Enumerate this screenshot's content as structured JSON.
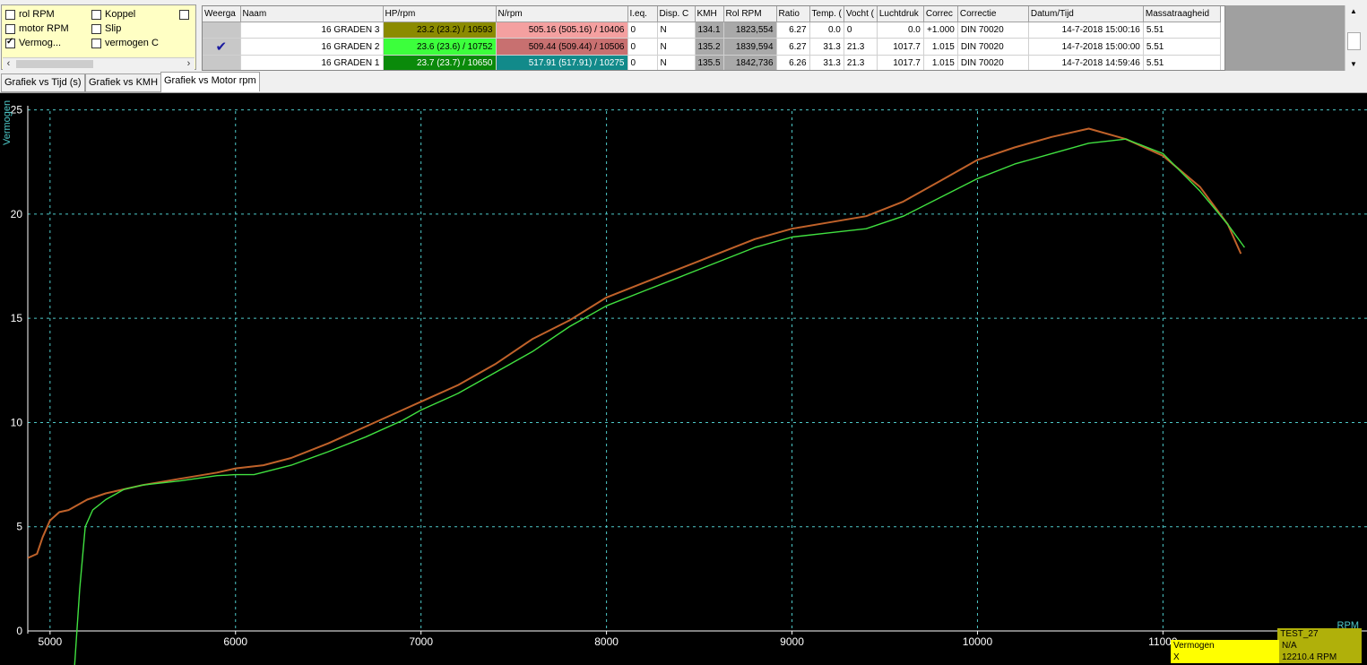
{
  "checkboxes": [
    {
      "label": "rol RPM",
      "checked": false
    },
    {
      "label": "Koppel",
      "checked": false
    },
    {
      "label": "",
      "checked": false
    },
    {
      "label": "motor RPM",
      "checked": false
    },
    {
      "label": "Slip",
      "checked": false
    },
    {
      "label": "Vermog...",
      "checked": true
    },
    {
      "label": "vermogen C",
      "checked": false
    }
  ],
  "table": {
    "columns": [
      "Weerga",
      "Naam",
      "HP/rpm",
      "N/rpm",
      "I.eq.",
      "Disp. C",
      "KMH",
      "Rol RPM",
      "Ratio",
      "Temp. (",
      "Vocht (",
      "Luchtdruk",
      "Correc",
      "Correctie",
      "Datum/Tijd",
      "Massatraagheid"
    ],
    "rows": [
      {
        "check": "",
        "name": "16 GRADEN 3",
        "hp": "23.2 (23.2) / 10593",
        "n": "505.16 (505.16) / 10406",
        "ieq": "0",
        "disp": "N",
        "kmh": "134.1",
        "rol": "1823,554",
        "ratio": "6.27",
        "temp": "0.0",
        "vocht": "0",
        "lucht": "0.0",
        "correc": "+1.000",
        "correctie": "DIN 70020",
        "datum": "14-7-2018 15:00:16",
        "massa": "5.51",
        "hp_color": "#8b8b00",
        "hp_text": "#000000",
        "n_color": "#f4a0a0",
        "n_text": "#000000"
      },
      {
        "check": "✔",
        "name": "16 GRADEN 2",
        "hp": "23.6 (23.6) / 10752",
        "n": "509.44 (509.44) / 10506",
        "ieq": "0",
        "disp": "N",
        "kmh": "135.2",
        "rol": "1839,594",
        "ratio": "6.27",
        "temp": "31.3",
        "vocht": "21.3",
        "lucht": "1017.7",
        "correc": "1.015",
        "correctie": "DIN 70020",
        "datum": "14-7-2018 15:00:00",
        "massa": "5.51",
        "hp_color": "#3cff3c",
        "hp_text": "#000000",
        "n_color": "#c87070",
        "n_text": "#000000"
      },
      {
        "check": "",
        "name": "16 GRADEN 1",
        "hp": "23.7 (23.7) / 10650",
        "n": "517.91 (517.91) / 10275",
        "ieq": "0",
        "disp": "N",
        "kmh": "135.5",
        "rol": "1842,736",
        "ratio": "6.26",
        "temp": "31.3",
        "vocht": "21.3",
        "lucht": "1017.7",
        "correc": "1.015",
        "correctie": "DIN 70020",
        "datum": "14-7-2018 14:59:46",
        "massa": "5.51",
        "hp_color": "#0a8a0a",
        "hp_text": "#ffffff",
        "n_color": "#128a8a",
        "n_text": "#ffffff"
      }
    ]
  },
  "tabs": [
    {
      "label": "Grafiek vs Tijd (s)",
      "active": false
    },
    {
      "label": "Grafiek vs KMH",
      "active": false
    },
    {
      "label": "Grafiek vs Motor rpm",
      "active": true
    }
  ],
  "legend": {
    "test": "TEST_27",
    "label": "Vermogen",
    "value": "N/A",
    "x_label": "X",
    "x_value": "12210.4 RPM"
  },
  "chart_data": {
    "type": "line",
    "ylabel": "Vermogen",
    "xlabel": "RPM",
    "xlim": [
      4880,
      12100
    ],
    "ylim": [
      0,
      25.8
    ],
    "xticks": [
      5000,
      6000,
      7000,
      8000,
      9000,
      10000,
      11000
    ],
    "yticks": [
      0,
      5,
      10,
      15,
      20,
      25
    ],
    "grid": true,
    "series": [
      {
        "color": "#c0622a",
        "points": [
          [
            4880,
            3.5
          ],
          [
            4930,
            3.7
          ],
          [
            4960,
            4.5
          ],
          [
            5000,
            5.3
          ],
          [
            5050,
            5.7
          ],
          [
            5100,
            5.8
          ],
          [
            5200,
            6.3
          ],
          [
            5300,
            6.6
          ],
          [
            5500,
            7.0
          ],
          [
            5700,
            7.3
          ],
          [
            5900,
            7.6
          ],
          [
            6000,
            7.8
          ],
          [
            6150,
            7.95
          ],
          [
            6300,
            8.3
          ],
          [
            6500,
            9.0
          ],
          [
            6700,
            9.8
          ],
          [
            6900,
            10.6
          ],
          [
            7000,
            11.0
          ],
          [
            7200,
            11.8
          ],
          [
            7400,
            12.8
          ],
          [
            7600,
            14.0
          ],
          [
            7800,
            14.9
          ],
          [
            8000,
            16.0
          ],
          [
            8200,
            16.7
          ],
          [
            8400,
            17.4
          ],
          [
            8600,
            18.1
          ],
          [
            8800,
            18.8
          ],
          [
            9000,
            19.3
          ],
          [
            9200,
            19.6
          ],
          [
            9400,
            19.9
          ],
          [
            9600,
            20.6
          ],
          [
            9800,
            21.6
          ],
          [
            10000,
            22.6
          ],
          [
            10200,
            23.2
          ],
          [
            10400,
            23.7
          ],
          [
            10600,
            24.1
          ],
          [
            10800,
            23.6
          ],
          [
            11000,
            22.8
          ],
          [
            11200,
            21.3
          ],
          [
            11350,
            19.5
          ],
          [
            11420,
            18.1
          ]
        ]
      },
      {
        "color": "#40e040",
        "points": [
          [
            5130,
            -2
          ],
          [
            5160,
            2.0
          ],
          [
            5190,
            5.0
          ],
          [
            5230,
            5.8
          ],
          [
            5300,
            6.3
          ],
          [
            5400,
            6.8
          ],
          [
            5500,
            7.0
          ],
          [
            5700,
            7.2
          ],
          [
            5900,
            7.45
          ],
          [
            6000,
            7.5
          ],
          [
            6100,
            7.5
          ],
          [
            6300,
            7.95
          ],
          [
            6500,
            8.6
          ],
          [
            6700,
            9.3
          ],
          [
            6900,
            10.1
          ],
          [
            7000,
            10.6
          ],
          [
            7200,
            11.4
          ],
          [
            7400,
            12.4
          ],
          [
            7600,
            13.4
          ],
          [
            7800,
            14.6
          ],
          [
            8000,
            15.6
          ],
          [
            8200,
            16.3
          ],
          [
            8400,
            17.0
          ],
          [
            8600,
            17.7
          ],
          [
            8800,
            18.4
          ],
          [
            9000,
            18.9
          ],
          [
            9200,
            19.1
          ],
          [
            9400,
            19.3
          ],
          [
            9600,
            19.9
          ],
          [
            9800,
            20.8
          ],
          [
            10000,
            21.7
          ],
          [
            10200,
            22.4
          ],
          [
            10400,
            22.9
          ],
          [
            10600,
            23.4
          ],
          [
            10800,
            23.6
          ],
          [
            11000,
            22.9
          ],
          [
            11200,
            21.1
          ],
          [
            11350,
            19.5
          ],
          [
            11440,
            18.4
          ]
        ]
      }
    ]
  }
}
